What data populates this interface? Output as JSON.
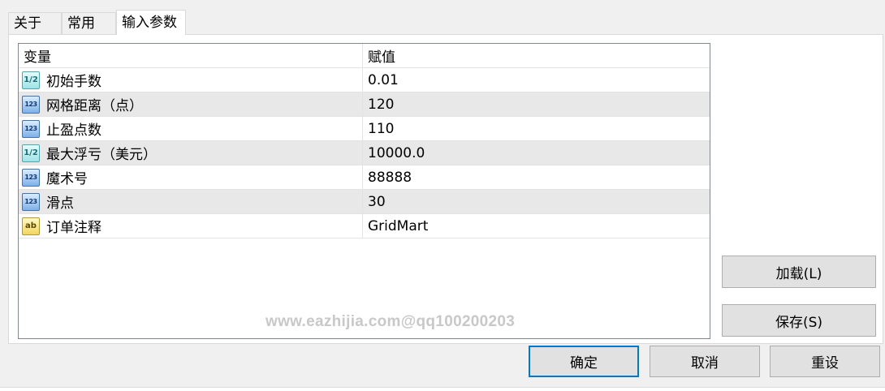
{
  "tabs": [
    {
      "label": "关于"
    },
    {
      "label": "常用"
    },
    {
      "label": "输入参数"
    }
  ],
  "grid": {
    "columns": {
      "variable": "变量",
      "value": "赋值"
    },
    "rows": [
      {
        "type": "double",
        "icon": "1/2",
        "name": "初始手数",
        "value": "0.01"
      },
      {
        "type": "int",
        "icon": "123",
        "name": "网格距离（点）",
        "value": "120"
      },
      {
        "type": "int",
        "icon": "123",
        "name": "止盈点数",
        "value": "110"
      },
      {
        "type": "double",
        "icon": "1/2",
        "name": "最大浮亏（美元）",
        "value": "10000.0"
      },
      {
        "type": "int",
        "icon": "123",
        "name": "魔术号",
        "value": "88888"
      },
      {
        "type": "int",
        "icon": "123",
        "name": "滑点",
        "value": "30"
      },
      {
        "type": "string",
        "icon": "ab",
        "name": "订单注释",
        "value": "GridMart"
      }
    ]
  },
  "watermark": "www.eazhijia.com@qq100200203",
  "buttons": {
    "load": "加载(L)",
    "save": "保存(S)",
    "ok": "确定",
    "cancel": "取消",
    "reset": "重设"
  }
}
